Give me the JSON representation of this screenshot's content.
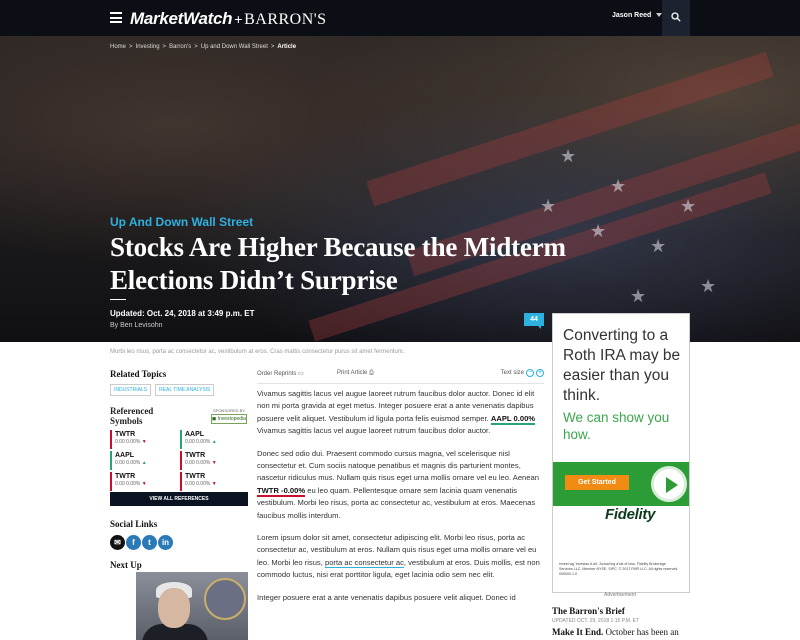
{
  "header": {
    "logo_main": "MarketWatch",
    "logo_plus": "+",
    "logo_partner": "BARRON'S",
    "user_name": "Jason Reed"
  },
  "breadcrumb": [
    "Home",
    ">",
    "Investing",
    ">",
    "Barron's",
    ">",
    "Up and Down Wall Street",
    ">",
    "Article"
  ],
  "article": {
    "section": "Up And Down Wall Street",
    "headline": "Stocks Are Higher Because the Midterm Elections Didn’t Surprise",
    "updated": "Updated: Oct. 24, 2018 at 3:49 p.m. ET",
    "byline": "By Ben Levisohn",
    "comment_count": "44",
    "caption": "Morbi leo risus, porta ac consectetur ac, vestibulum at eros. Cras mattis consectetur purus sit amet fermentum."
  },
  "toolbar": {
    "order_reprints": "Order Reprints",
    "print_article": "Print Article",
    "text_size": "Text size",
    "minus": "−",
    "plus": "+"
  },
  "body": {
    "p1a": "Vivamus sagittis lacus vel augue laoreet rutrum faucibus dolor auctor. Donec id elit non mi porta gravida at eget metus. Integer posuere erat a ante venenatis dapibus posuere velit aliquet. Vestibulum id ligula porta felis euismod semper.",
    "p1_ticker": "AAPL 0.00%",
    "p1b": "Vivamus sagittis lacus vel augue laoreet rutrum faucibus dolor auctor.",
    "p2a": "Donec sed odio dui. Praesent commodo cursus magna, vel scelerisque nisl consectetur et. Cum sociis natoque penatibus et magnis dis parturient montes, nascetur ridiculus mus. Nullam quis risus eget urna mollis ornare vel eu leo. Aenean",
    "p2_ticker": "TWTR -0.00%",
    "p2b": "eu leo quam. Pellentesque ornare sem lacinia quam venenatis vestibulum. Morbi leo risus, porta ac consectetur ac, vestibulum at eros. Maecenas faucibus mollis interdum.",
    "p3a": "Lorem ipsum dolor sit amet, consectetur adipiscing elit. Morbi leo risus, porta ac consectetur ac, vestibulum at eros. Nullam quis risus eget urna mollis ornare vel eu leo. Morbi leo risus,",
    "p3_link": "porta ac consectetur ac",
    "p3b": ", vestibulum at eros. Duis mollis, est non commodo luctus, nisi erat porttitor ligula, eget lacinia odio sem nec elit.",
    "p4": "Integer posuere erat a ante venenatis dapibus posuere velit aliquet. Donec id"
  },
  "sidebar": {
    "related_title": "Related Topics",
    "tags": [
      "INDUSTRIALS",
      "REAL TIME ANALYSIS"
    ],
    "refs_title": "Referenced Symbols",
    "sponsored_by": "SPONSORED BY",
    "sponsor_name": "◼ Investopedia",
    "refs": [
      {
        "sym": "TWTR",
        "val": "0.00 0.00%",
        "dir": "down"
      },
      {
        "sym": "AAPL",
        "val": "0.00 0.00%",
        "dir": "up"
      },
      {
        "sym": "AAPL",
        "val": "0.00 0.00%",
        "dir": "up"
      },
      {
        "sym": "TWTR",
        "val": "0.00 0.00%",
        "dir": "down"
      },
      {
        "sym": "TWTR",
        "val": "0.00 0.00%",
        "dir": "down"
      },
      {
        "sym": "TWTR",
        "val": "0.00 0.00%",
        "dir": "down"
      }
    ],
    "view_all": "VIEW ALL REFERENCES",
    "social_title": "Social Links",
    "social": [
      "✉",
      "f",
      "t",
      "in"
    ],
    "next_up": "Next Up"
  },
  "ad": {
    "line1": "Converting to a Roth IRA may be easier than you think.",
    "line2": "We can show you how.",
    "cta": "Get Started",
    "brand": "Fidelity",
    "fine": "Invest wg 'investas A ait, 'Actual ing a'sik of loss. Fidelity Brokerage Services LLC, Member NYSE, SIPC. © 2017 FMR LLC. All rights reserved. 000000.1.0",
    "label": "Advertisement"
  },
  "brief": {
    "title": "The Barron's Brief",
    "updated": "UPDATED OCT. 29, 2018 1:15 P.M. ET",
    "headline_bold": "Make It End.",
    "headline_rest": " October has been an"
  },
  "colors": {
    "accent": "#2cb1e0",
    "down": "#c8102e",
    "up": "#2aa37a",
    "topbar": "#0b0e14"
  }
}
